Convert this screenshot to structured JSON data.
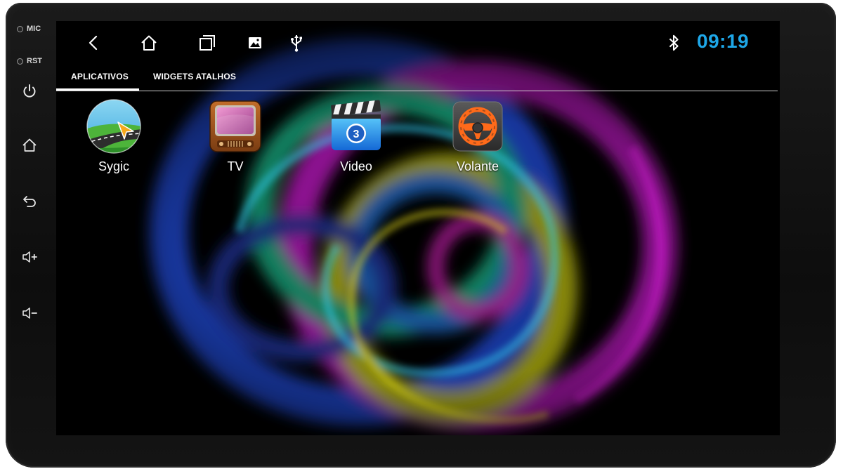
{
  "side_panel": {
    "mic_label": "MIC",
    "rst_label": "RST",
    "buttons": [
      "power-icon",
      "home-icon",
      "back-icon",
      "volume-up-icon",
      "volume-down-icon"
    ]
  },
  "status_bar": {
    "nav_icons": [
      "back-icon",
      "home-icon",
      "recents-icon",
      "gallery-icon",
      "usb-icon"
    ],
    "bluetooth_icon": "bluetooth-icon",
    "time": "09:19",
    "time_color": "#1ea7e8"
  },
  "tabs": [
    {
      "label": "APLICATIVOS",
      "active": true
    },
    {
      "label": "WIDGETS ATALHOS",
      "active": false
    }
  ],
  "apps": [
    {
      "label": "Sygic",
      "icon": "sygic-icon"
    },
    {
      "label": "TV",
      "icon": "tv-icon"
    },
    {
      "label": "Video",
      "icon": "video-icon"
    },
    {
      "label": "Volante",
      "icon": "steering-wheel-icon"
    }
  ]
}
